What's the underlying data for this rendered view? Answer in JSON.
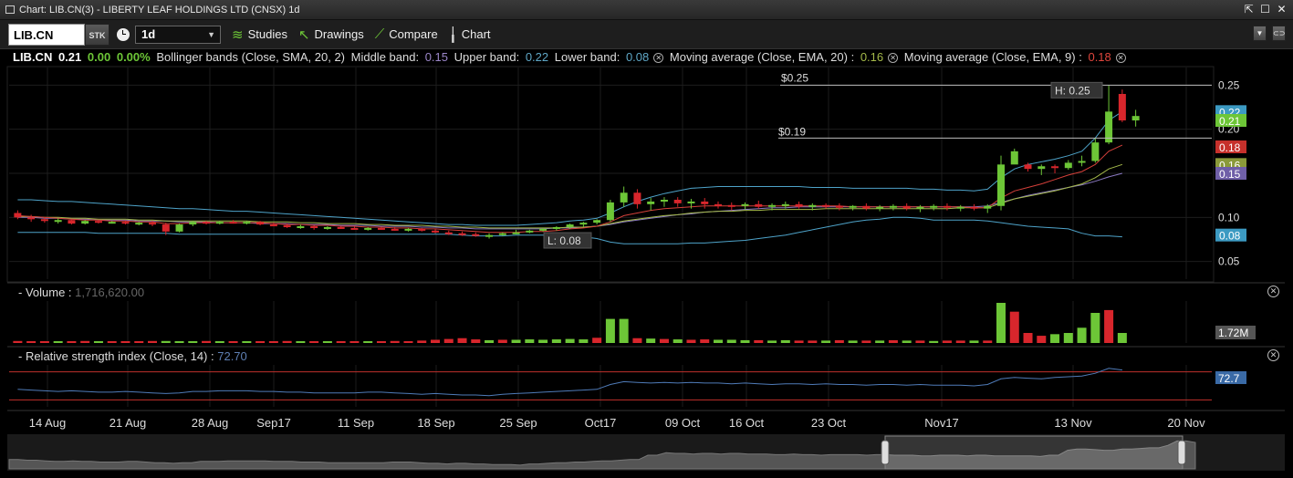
{
  "window": {
    "title": "Chart: LIB.CN(3) - LIBERTY LEAF HOLDINGS LTD (CNSX) 1d"
  },
  "toolbar": {
    "symbol": "LIB.CN",
    "type_badge": "STK",
    "period": "1d",
    "studies_label": "Studies",
    "drawings_label": "Drawings",
    "compare_label": "Compare",
    "chart_label": "Chart"
  },
  "legend": {
    "symbol": "LIB.CN",
    "last": "0.21",
    "change": "0.00",
    "change_pct": "0.00%",
    "bb_label": "Bollinger bands (Close, SMA, 20, 2)",
    "middle_label": "Middle band:",
    "middle_value": "0.15",
    "upper_label": "Upper band:",
    "upper_value": "0.22",
    "lower_label": "Lower band:",
    "lower_value": "0.08",
    "ema20_label": "Moving average (Close, EMA, 20) :",
    "ema20_value": "0.16",
    "ema9_label": "Moving average (Close, EMA, 9) :",
    "ema9_value": "0.18"
  },
  "annotations": {
    "high_line_label": "$0.25",
    "low_line_label": "$0.19",
    "high_label": "H: 0.25",
    "low_label": "L: 0.08"
  },
  "volume_panel": {
    "title": "- Volume :",
    "value": "1,716,620.00",
    "badge": "1.72M"
  },
  "rsi_panel": {
    "title": "- Relative strength index (Close, 14) :",
    "value": "72.70",
    "badge": "72.7",
    "upper_level": 70,
    "lower_level": 30
  },
  "colors": {
    "up": "#6dc637",
    "down": "#d8262c",
    "upper_band": "#4ea3c9",
    "middle_band": "#8a79c2",
    "ema20": "#a4b94a",
    "ema9": "#d5403a",
    "rsi_line": "#4f7bb8",
    "rsi_level": "#c0302b"
  },
  "chart_data": {
    "type": "candlestick",
    "price_axis": {
      "ticks": [
        "0.25",
        "0.20",
        "0.15",
        "0.10",
        "0.05"
      ],
      "range": [
        0.03,
        0.27
      ]
    },
    "price_badges": [
      {
        "label": "0.22",
        "value": 0.22,
        "color": "#3c9ac2"
      },
      {
        "label": "0.21",
        "value": 0.21,
        "color": "#6dc637"
      },
      {
        "label": "0.18",
        "value": 0.18,
        "color": "#c6302b"
      },
      {
        "label": "0.16",
        "value": 0.16,
        "color": "#8a9a3a"
      },
      {
        "label": "0.15",
        "value": 0.15,
        "color": "#6f5fa8"
      },
      {
        "label": "0.08",
        "value": 0.08,
        "color": "#3c9ac2"
      }
    ],
    "date_ticks": [
      "14 Aug",
      "21 Aug",
      "28 Aug",
      "Sep17",
      "11 Sep",
      "18 Sep",
      "25 Sep",
      "Oct17",
      "09 Oct",
      "16 Oct",
      "23 Oct",
      "Nov17",
      "13 Nov",
      "20 Nov"
    ],
    "candles": [
      [
        0.105,
        0.108,
        0.098,
        0.1
      ],
      [
        0.1,
        0.103,
        0.095,
        0.098
      ],
      [
        0.098,
        0.1,
        0.094,
        0.096
      ],
      [
        0.096,
        0.099,
        0.093,
        0.097
      ],
      [
        0.097,
        0.098,
        0.092,
        0.093
      ],
      [
        0.093,
        0.097,
        0.092,
        0.096
      ],
      [
        0.096,
        0.097,
        0.093,
        0.094
      ],
      [
        0.094,
        0.096,
        0.093,
        0.095
      ],
      [
        0.095,
        0.096,
        0.092,
        0.093
      ],
      [
        0.093,
        0.095,
        0.091,
        0.094
      ],
      [
        0.094,
        0.096,
        0.09,
        0.092
      ],
      [
        0.092,
        0.094,
        0.08,
        0.084
      ],
      [
        0.084,
        0.093,
        0.083,
        0.092
      ],
      [
        0.092,
        0.096,
        0.09,
        0.095
      ],
      [
        0.095,
        0.096,
        0.092,
        0.093
      ],
      [
        0.093,
        0.096,
        0.092,
        0.095
      ],
      [
        0.095,
        0.097,
        0.093,
        0.094
      ],
      [
        0.094,
        0.096,
        0.092,
        0.095
      ],
      [
        0.095,
        0.096,
        0.091,
        0.092
      ],
      [
        0.092,
        0.094,
        0.09,
        0.091
      ],
      [
        0.091,
        0.093,
        0.088,
        0.089
      ],
      [
        0.089,
        0.092,
        0.087,
        0.09
      ],
      [
        0.09,
        0.091,
        0.086,
        0.088
      ],
      [
        0.088,
        0.09,
        0.086,
        0.089
      ],
      [
        0.089,
        0.09,
        0.087,
        0.088
      ],
      [
        0.088,
        0.09,
        0.086,
        0.087
      ],
      [
        0.087,
        0.089,
        0.085,
        0.088
      ],
      [
        0.088,
        0.089,
        0.086,
        0.087
      ],
      [
        0.087,
        0.089,
        0.085,
        0.086
      ],
      [
        0.086,
        0.088,
        0.084,
        0.087
      ],
      [
        0.087,
        0.088,
        0.084,
        0.085
      ],
      [
        0.085,
        0.087,
        0.082,
        0.083
      ],
      [
        0.083,
        0.085,
        0.08,
        0.082
      ],
      [
        0.082,
        0.084,
        0.079,
        0.081
      ],
      [
        0.081,
        0.083,
        0.078,
        0.079
      ],
      [
        0.079,
        0.082,
        0.076,
        0.08
      ],
      [
        0.08,
        0.083,
        0.079,
        0.082
      ],
      [
        0.082,
        0.086,
        0.081,
        0.083
      ],
      [
        0.083,
        0.086,
        0.082,
        0.085
      ],
      [
        0.085,
        0.088,
        0.084,
        0.087
      ],
      [
        0.087,
        0.09,
        0.085,
        0.089
      ],
      [
        0.089,
        0.093,
        0.087,
        0.092
      ],
      [
        0.092,
        0.095,
        0.089,
        0.094
      ],
      [
        0.094,
        0.098,
        0.092,
        0.097
      ],
      [
        0.097,
        0.12,
        0.095,
        0.117
      ],
      [
        0.117,
        0.135,
        0.112,
        0.128
      ],
      [
        0.128,
        0.132,
        0.11,
        0.115
      ],
      [
        0.115,
        0.122,
        0.108,
        0.118
      ],
      [
        0.118,
        0.123,
        0.112,
        0.12
      ],
      [
        0.12,
        0.123,
        0.112,
        0.116
      ],
      [
        0.116,
        0.121,
        0.11,
        0.118
      ],
      [
        0.118,
        0.122,
        0.11,
        0.115
      ],
      [
        0.115,
        0.118,
        0.11,
        0.114
      ],
      [
        0.114,
        0.117,
        0.108,
        0.113
      ],
      [
        0.113,
        0.117,
        0.109,
        0.115
      ],
      [
        0.115,
        0.119,
        0.11,
        0.112
      ],
      [
        0.112,
        0.116,
        0.108,
        0.114
      ],
      [
        0.114,
        0.118,
        0.11,
        0.115
      ],
      [
        0.115,
        0.118,
        0.11,
        0.112
      ],
      [
        0.112,
        0.116,
        0.108,
        0.114
      ],
      [
        0.114,
        0.116,
        0.11,
        0.113
      ],
      [
        0.113,
        0.116,
        0.108,
        0.111
      ],
      [
        0.111,
        0.114,
        0.108,
        0.113
      ],
      [
        0.113,
        0.116,
        0.108,
        0.11
      ],
      [
        0.11,
        0.114,
        0.107,
        0.112
      ],
      [
        0.112,
        0.115,
        0.108,
        0.113
      ],
      [
        0.113,
        0.116,
        0.108,
        0.11
      ],
      [
        0.11,
        0.114,
        0.106,
        0.112
      ],
      [
        0.112,
        0.115,
        0.108,
        0.113
      ],
      [
        0.113,
        0.116,
        0.108,
        0.111
      ],
      [
        0.111,
        0.114,
        0.107,
        0.112
      ],
      [
        0.112,
        0.115,
        0.108,
        0.11
      ],
      [
        0.11,
        0.115,
        0.105,
        0.113
      ],
      [
        0.113,
        0.17,
        0.108,
        0.16
      ],
      [
        0.16,
        0.178,
        0.162,
        0.175
      ],
      [
        0.16,
        0.162,
        0.152,
        0.155
      ],
      [
        0.155,
        0.16,
        0.148,
        0.158
      ],
      [
        0.158,
        0.16,
        0.15,
        0.156
      ],
      [
        0.156,
        0.165,
        0.154,
        0.162
      ],
      [
        0.162,
        0.17,
        0.158,
        0.164
      ],
      [
        0.164,
        0.19,
        0.162,
        0.185
      ],
      [
        0.185,
        0.25,
        0.183,
        0.22
      ],
      [
        0.24,
        0.245,
        0.208,
        0.21
      ],
      [
        0.21,
        0.222,
        0.203,
        0.215
      ]
    ],
    "volume_bars": [
      [
        0.05,
        "down"
      ],
      [
        0.04,
        "down"
      ],
      [
        0.04,
        "down"
      ],
      [
        0.03,
        "up"
      ],
      [
        0.04,
        "down"
      ],
      [
        0.05,
        "down"
      ],
      [
        0.04,
        "up"
      ],
      [
        0.03,
        "down"
      ],
      [
        0.04,
        "down"
      ],
      [
        0.04,
        "down"
      ],
      [
        0.05,
        "down"
      ],
      [
        0.05,
        "up"
      ],
      [
        0.04,
        "up"
      ],
      [
        0.04,
        "up"
      ],
      [
        0.05,
        "down"
      ],
      [
        0.04,
        "up"
      ],
      [
        0.04,
        "down"
      ],
      [
        0.04,
        "up"
      ],
      [
        0.04,
        "down"
      ],
      [
        0.04,
        "down"
      ],
      [
        0.05,
        "down"
      ],
      [
        0.04,
        "up"
      ],
      [
        0.04,
        "down"
      ],
      [
        0.04,
        "up"
      ],
      [
        0.04,
        "down"
      ],
      [
        0.04,
        "down"
      ],
      [
        0.04,
        "up"
      ],
      [
        0.04,
        "down"
      ],
      [
        0.05,
        "down"
      ],
      [
        0.04,
        "down"
      ],
      [
        0.06,
        "down"
      ],
      [
        0.08,
        "down"
      ],
      [
        0.1,
        "down"
      ],
      [
        0.12,
        "down"
      ],
      [
        0.09,
        "down"
      ],
      [
        0.07,
        "up"
      ],
      [
        0.08,
        "down"
      ],
      [
        0.08,
        "up"
      ],
      [
        0.09,
        "up"
      ],
      [
        0.08,
        "up"
      ],
      [
        0.09,
        "up"
      ],
      [
        0.1,
        "up"
      ],
      [
        0.09,
        "up"
      ],
      [
        0.13,
        "down"
      ],
      [
        0.6,
        "up"
      ],
      [
        0.6,
        "up"
      ],
      [
        0.12,
        "down"
      ],
      [
        0.11,
        "up"
      ],
      [
        0.1,
        "down"
      ],
      [
        0.09,
        "up"
      ],
      [
        0.08,
        "down"
      ],
      [
        0.09,
        "down"
      ],
      [
        0.08,
        "up"
      ],
      [
        0.08,
        "up"
      ],
      [
        0.07,
        "up"
      ],
      [
        0.07,
        "down"
      ],
      [
        0.06,
        "up"
      ],
      [
        0.07,
        "up"
      ],
      [
        0.06,
        "down"
      ],
      [
        0.06,
        "down"
      ],
      [
        0.06,
        "up"
      ],
      [
        0.07,
        "down"
      ],
      [
        0.06,
        "up"
      ],
      [
        0.06,
        "down"
      ],
      [
        0.06,
        "up"
      ],
      [
        0.07,
        "down"
      ],
      [
        0.06,
        "up"
      ],
      [
        0.06,
        "down"
      ],
      [
        0.05,
        "up"
      ],
      [
        0.06,
        "down"
      ],
      [
        0.06,
        "down"
      ],
      [
        0.06,
        "up"
      ],
      [
        0.06,
        "down"
      ],
      [
        1.0,
        "up"
      ],
      [
        0.78,
        "down"
      ],
      [
        0.25,
        "down"
      ],
      [
        0.18,
        "down"
      ],
      [
        0.22,
        "up"
      ],
      [
        0.25,
        "up"
      ],
      [
        0.38,
        "up"
      ],
      [
        0.75,
        "up"
      ],
      [
        0.82,
        "down"
      ],
      [
        0.25,
        "up"
      ]
    ],
    "upper_band": [
      0.12,
      0.12,
      0.119,
      0.118,
      0.118,
      0.117,
      0.116,
      0.115,
      0.114,
      0.113,
      0.112,
      0.111,
      0.11,
      0.11,
      0.109,
      0.108,
      0.107,
      0.107,
      0.106,
      0.105,
      0.104,
      0.103,
      0.102,
      0.101,
      0.1,
      0.099,
      0.098,
      0.097,
      0.096,
      0.095,
      0.094,
      0.093,
      0.092,
      0.092,
      0.091,
      0.091,
      0.091,
      0.091,
      0.092,
      0.093,
      0.094,
      0.096,
      0.097,
      0.099,
      0.105,
      0.112,
      0.118,
      0.123,
      0.127,
      0.13,
      0.133,
      0.134,
      0.135,
      0.135,
      0.135,
      0.135,
      0.135,
      0.135,
      0.135,
      0.134,
      0.134,
      0.134,
      0.133,
      0.133,
      0.133,
      0.133,
      0.133,
      0.132,
      0.132,
      0.131,
      0.131,
      0.13,
      0.132,
      0.145,
      0.155,
      0.16,
      0.163,
      0.166,
      0.17,
      0.175,
      0.19,
      0.21,
      0.22
    ],
    "middle_band": [
      0.1,
      0.1,
      0.099,
      0.099,
      0.098,
      0.098,
      0.097,
      0.097,
      0.097,
      0.096,
      0.096,
      0.096,
      0.095,
      0.095,
      0.095,
      0.094,
      0.094,
      0.094,
      0.093,
      0.093,
      0.093,
      0.092,
      0.092,
      0.092,
      0.091,
      0.091,
      0.091,
      0.09,
      0.09,
      0.09,
      0.089,
      0.089,
      0.088,
      0.088,
      0.087,
      0.087,
      0.087,
      0.087,
      0.087,
      0.087,
      0.088,
      0.088,
      0.089,
      0.09,
      0.092,
      0.095,
      0.097,
      0.099,
      0.101,
      0.103,
      0.104,
      0.106,
      0.107,
      0.108,
      0.109,
      0.11,
      0.111,
      0.111,
      0.112,
      0.112,
      0.112,
      0.112,
      0.112,
      0.112,
      0.112,
      0.112,
      0.112,
      0.112,
      0.112,
      0.112,
      0.112,
      0.112,
      0.113,
      0.117,
      0.121,
      0.125,
      0.128,
      0.131,
      0.134,
      0.137,
      0.141,
      0.146,
      0.15
    ],
    "lower_band": [
      0.083,
      0.083,
      0.083,
      0.083,
      0.083,
      0.083,
      0.082,
      0.082,
      0.082,
      0.082,
      0.082,
      0.082,
      0.081,
      0.081,
      0.081,
      0.081,
      0.081,
      0.081,
      0.081,
      0.081,
      0.081,
      0.081,
      0.081,
      0.081,
      0.081,
      0.081,
      0.081,
      0.081,
      0.081,
      0.081,
      0.081,
      0.081,
      0.081,
      0.08,
      0.079,
      0.079,
      0.079,
      0.08,
      0.08,
      0.08,
      0.08,
      0.079,
      0.078,
      0.076,
      0.072,
      0.07,
      0.07,
      0.07,
      0.07,
      0.07,
      0.071,
      0.071,
      0.072,
      0.073,
      0.074,
      0.076,
      0.078,
      0.08,
      0.083,
      0.086,
      0.089,
      0.092,
      0.095,
      0.097,
      0.098,
      0.1,
      0.1,
      0.099,
      0.097,
      0.097,
      0.097,
      0.097,
      0.096,
      0.094,
      0.092,
      0.09,
      0.089,
      0.088,
      0.087,
      0.082,
      0.079,
      0.079,
      0.078
    ],
    "ema20": [
      0.101,
      0.101,
      0.1,
      0.1,
      0.099,
      0.099,
      0.098,
      0.098,
      0.098,
      0.097,
      0.097,
      0.096,
      0.096,
      0.096,
      0.096,
      0.096,
      0.096,
      0.096,
      0.095,
      0.095,
      0.095,
      0.094,
      0.094,
      0.093,
      0.093,
      0.093,
      0.092,
      0.092,
      0.091,
      0.091,
      0.091,
      0.09,
      0.09,
      0.089,
      0.089,
      0.088,
      0.088,
      0.088,
      0.088,
      0.088,
      0.088,
      0.089,
      0.089,
      0.09,
      0.093,
      0.096,
      0.098,
      0.1,
      0.102,
      0.103,
      0.105,
      0.106,
      0.107,
      0.107,
      0.108,
      0.108,
      0.109,
      0.109,
      0.109,
      0.109,
      0.11,
      0.11,
      0.11,
      0.11,
      0.11,
      0.11,
      0.11,
      0.11,
      0.11,
      0.11,
      0.111,
      0.111,
      0.111,
      0.116,
      0.121,
      0.124,
      0.127,
      0.13,
      0.134,
      0.138,
      0.145,
      0.155,
      0.16
    ],
    "ema9": [
      0.102,
      0.101,
      0.1,
      0.099,
      0.098,
      0.097,
      0.097,
      0.096,
      0.096,
      0.095,
      0.095,
      0.093,
      0.093,
      0.094,
      0.094,
      0.094,
      0.094,
      0.094,
      0.094,
      0.093,
      0.092,
      0.092,
      0.091,
      0.091,
      0.09,
      0.09,
      0.089,
      0.089,
      0.088,
      0.088,
      0.087,
      0.087,
      0.086,
      0.085,
      0.084,
      0.083,
      0.083,
      0.083,
      0.084,
      0.084,
      0.085,
      0.087,
      0.088,
      0.09,
      0.095,
      0.102,
      0.105,
      0.108,
      0.11,
      0.111,
      0.112,
      0.113,
      0.113,
      0.113,
      0.113,
      0.113,
      0.113,
      0.113,
      0.113,
      0.113,
      0.113,
      0.113,
      0.112,
      0.112,
      0.112,
      0.112,
      0.112,
      0.112,
      0.112,
      0.112,
      0.112,
      0.111,
      0.111,
      0.122,
      0.13,
      0.134,
      0.138,
      0.143,
      0.148,
      0.152,
      0.16,
      0.175,
      0.182
    ],
    "rsi": [
      45,
      44,
      43,
      42,
      43,
      42,
      41,
      41,
      42,
      41,
      40,
      39,
      40,
      42,
      42,
      43,
      43,
      43,
      42,
      42,
      41,
      41,
      40,
      40,
      40,
      40,
      41,
      41,
      40,
      39,
      38,
      39,
      38,
      37,
      37,
      36,
      38,
      39,
      40,
      41,
      42,
      43,
      44,
      45,
      52,
      56,
      55,
      54,
      55,
      54,
      55,
      54,
      54,
      53,
      54,
      53,
      52,
      53,
      53,
      52,
      53,
      52,
      52,
      51,
      52,
      52,
      51,
      52,
      51,
      51,
      51,
      50,
      52,
      60,
      62,
      61,
      60,
      62,
      63,
      64,
      68,
      75,
      72.7
    ]
  }
}
